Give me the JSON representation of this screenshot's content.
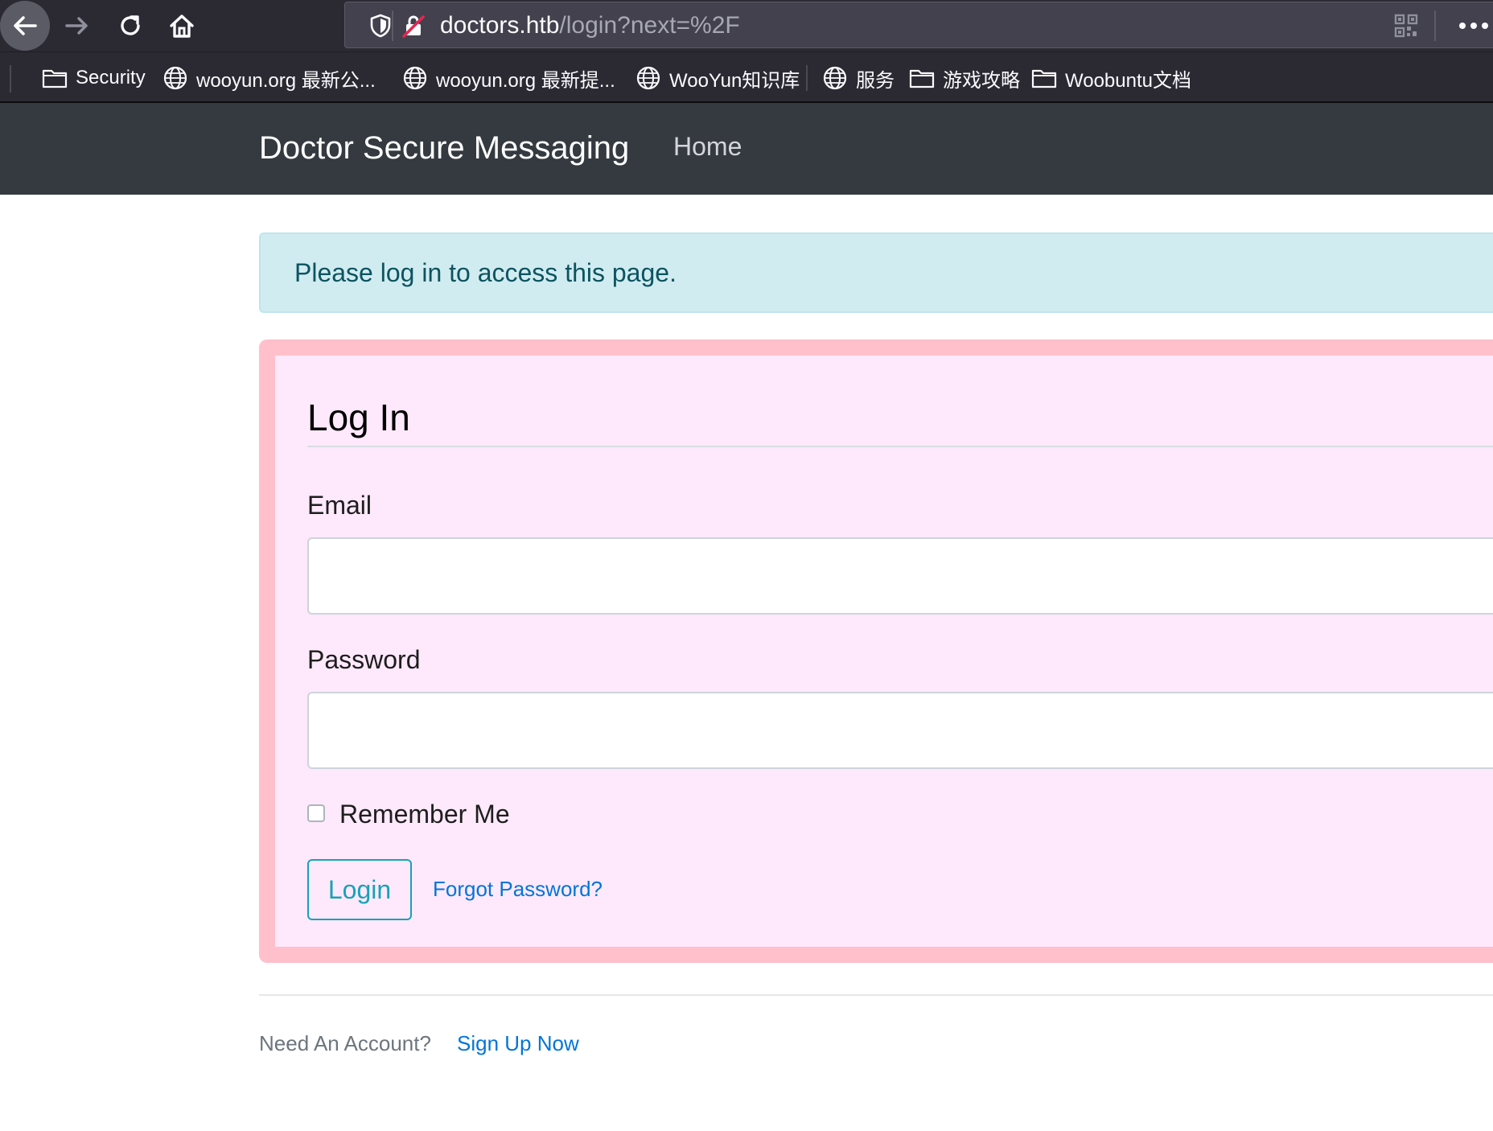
{
  "browser": {
    "url_host": "doctors.htb",
    "url_path": "/login?next=%2F",
    "bookmarks": [
      {
        "label": "Security",
        "icon": "folder-icon"
      },
      {
        "label": "wooyun.org 最新公...",
        "icon": "globe-icon"
      },
      {
        "label": "wooyun.org 最新提...",
        "icon": "globe-icon"
      },
      {
        "label": "WooYun知识库",
        "icon": "globe-icon"
      },
      {
        "label": "服务",
        "icon": "globe-icon"
      },
      {
        "label": "游戏攻略",
        "icon": "folder-icon"
      },
      {
        "label": "Woobuntu文档",
        "icon": "folder-icon"
      }
    ]
  },
  "navbar": {
    "brand": "Doctor Secure Messaging",
    "home": "Home"
  },
  "alert": {
    "message": "Please log in to access this page."
  },
  "login": {
    "title": "Log In",
    "email_label": "Email",
    "email_value": "",
    "password_label": "Password",
    "password_value": "",
    "remember_label": "Remember Me",
    "remember_checked": false,
    "submit_label": "Login",
    "forgot_label": "Forgot Password?"
  },
  "footer": {
    "prompt": "Need An Account?",
    "signup_label": "Sign Up Now"
  },
  "colors": {
    "navbar_bg": "#343a40",
    "alert_bg": "#d1ecf1",
    "card_bg": "#fde9fb",
    "card_border": "#ffc0cb",
    "accent": "#17a2b8",
    "link": "#0275d8"
  }
}
